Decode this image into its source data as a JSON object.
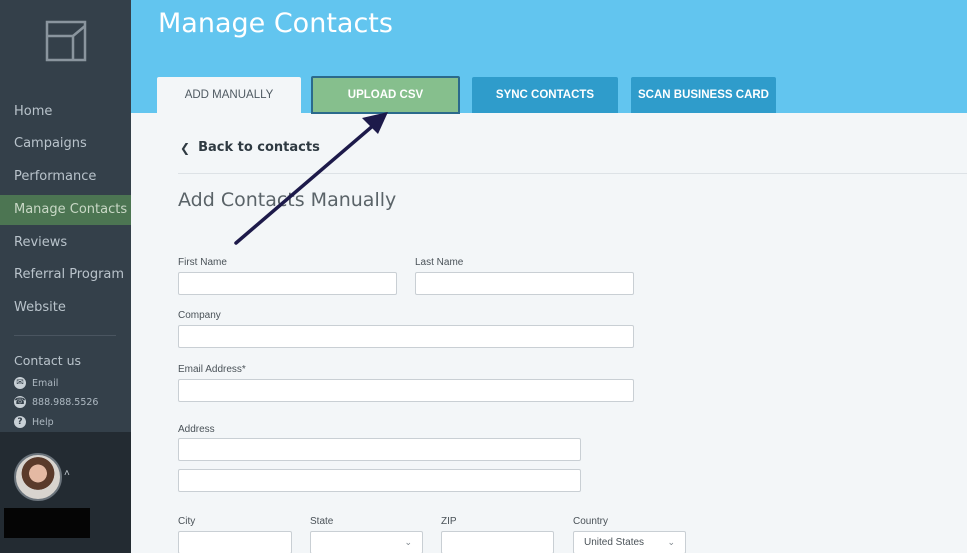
{
  "app": {
    "page_title": "Manage Contacts"
  },
  "sidebar": {
    "logo": "logo-mark",
    "items": [
      {
        "label": "Home",
        "active": false
      },
      {
        "label": "Campaigns",
        "active": false
      },
      {
        "label": "Performance",
        "active": false
      },
      {
        "label": "Manage Contacts",
        "active": true
      },
      {
        "label": "Reviews",
        "active": false
      },
      {
        "label": "Referral Program",
        "active": false
      },
      {
        "label": "Website",
        "active": false
      }
    ],
    "contact": {
      "heading": "Contact us",
      "email_label": "Email",
      "phone": "888.988.5526",
      "help_label": "Help"
    }
  },
  "tabs": [
    {
      "label": "ADD MANUALLY",
      "active": true
    },
    {
      "label": "UPLOAD CSV",
      "active": false,
      "highlighted": true
    },
    {
      "label": "SYNC CONTACTS",
      "active": false
    },
    {
      "label": "SCAN BUSINESS CARD",
      "active": false
    }
  ],
  "main": {
    "back_link": "Back to contacts",
    "section_title": "Add Contacts Manually"
  },
  "form": {
    "first_name": {
      "label": "First Name",
      "value": ""
    },
    "last_name": {
      "label": "Last Name",
      "value": ""
    },
    "company": {
      "label": "Company",
      "value": ""
    },
    "email": {
      "label": "Email Address*",
      "value": ""
    },
    "address": {
      "label": "Address",
      "line1": "",
      "line2": ""
    },
    "city": {
      "label": "City",
      "value": ""
    },
    "state": {
      "label": "State",
      "value": ""
    },
    "zip": {
      "label": "ZIP",
      "value": ""
    },
    "country": {
      "label": "Country",
      "value": "United States"
    }
  },
  "colors": {
    "sidebar_bg": "#34404a",
    "sidebar_active": "#4c7552",
    "header_bg": "#62c5ef",
    "tab_bg": "#2f9ccb",
    "upload_tab_bg": "#86bf8d",
    "arrow": "#1d1a4a"
  }
}
